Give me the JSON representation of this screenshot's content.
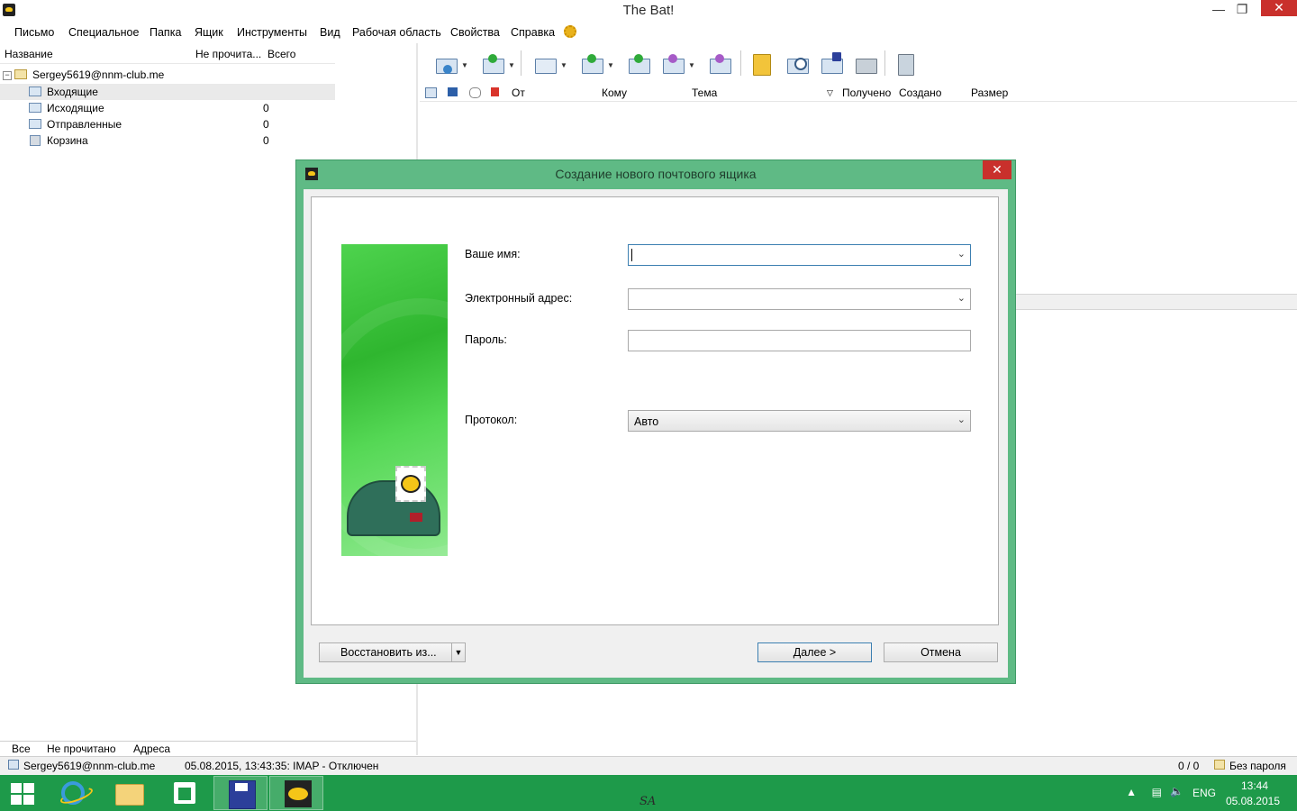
{
  "window": {
    "title": "The Bat!"
  },
  "menu": [
    "Письмо",
    "Специальное",
    "Папка",
    "Ящик",
    "Инструменты",
    "Вид",
    "Рабочая область",
    "Свойства",
    "Справка"
  ],
  "folder_panel": {
    "columns": {
      "name": "Название",
      "unread": "Не прочита...",
      "total": "Всего"
    },
    "account": "Sergey5619@nnm-club.me",
    "folders": [
      {
        "label": "Входящие",
        "count": "",
        "icon": "inbox-icon"
      },
      {
        "label": "Исходящие",
        "count": "0",
        "icon": "outbox-icon"
      },
      {
        "label": "Отправленные",
        "count": "0",
        "icon": "sent-icon"
      },
      {
        "label": "Корзина",
        "count": "0",
        "icon": "trash-icon"
      }
    ],
    "tabs": [
      "Все",
      "Не прочитано",
      "Адреса"
    ]
  },
  "message_list": {
    "columns": {
      "from": "От",
      "to": "Кому",
      "subject": "Тема",
      "received": "Получено",
      "created": "Создано",
      "size": "Размер"
    }
  },
  "dialog": {
    "title": "Создание нового почтового ящика",
    "fields": {
      "name_label": "Ваше имя:",
      "name_value": "",
      "email_label": "Электронный адрес:",
      "email_value": "",
      "password_label": "Пароль:",
      "password_value": "",
      "protocol_label": "Протокол:",
      "protocol_value": "Авто"
    },
    "buttons": {
      "restore": "Восстановить из...",
      "next": "Далее  >",
      "cancel": "Отмена"
    }
  },
  "status_bar": {
    "account": "Sergey5619@nnm-club.me",
    "log": "05.08.2015, 13:43:35: IMAP  - Отключен",
    "counter": "0 / 0",
    "security": "Без пароля"
  },
  "taskbar": {
    "watermark": "SA",
    "language": "ENG",
    "time": "13:44",
    "date": "05.08.2015"
  },
  "colors": {
    "dialog_frame": "#5fba85",
    "taskbar": "#1e9a4a",
    "close_button": "#c9302c"
  }
}
